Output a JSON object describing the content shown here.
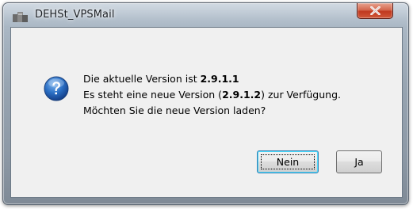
{
  "window": {
    "title": "DEHSt_VPSMail",
    "app_icon": "app-window-icon",
    "close_icon": "close-icon"
  },
  "dialog": {
    "icon": "question-icon",
    "line1_prefix": "Die aktuelle Version ist ",
    "current_version": "2.9.1.1",
    "line2_prefix": "Es steht eine neue Version (",
    "new_version": "2.9.1.2",
    "line2_suffix": ") zur Verfügung.",
    "line3": "Möchten Sie die neue Version laden?"
  },
  "buttons": {
    "no_label": "Nein",
    "yes_label": "Ja"
  },
  "colors": {
    "title_bar": "#9eabb8",
    "close_button": "#c8452a",
    "client_background": "#f0f0f0",
    "focus_accent": "#3c7fb1"
  }
}
